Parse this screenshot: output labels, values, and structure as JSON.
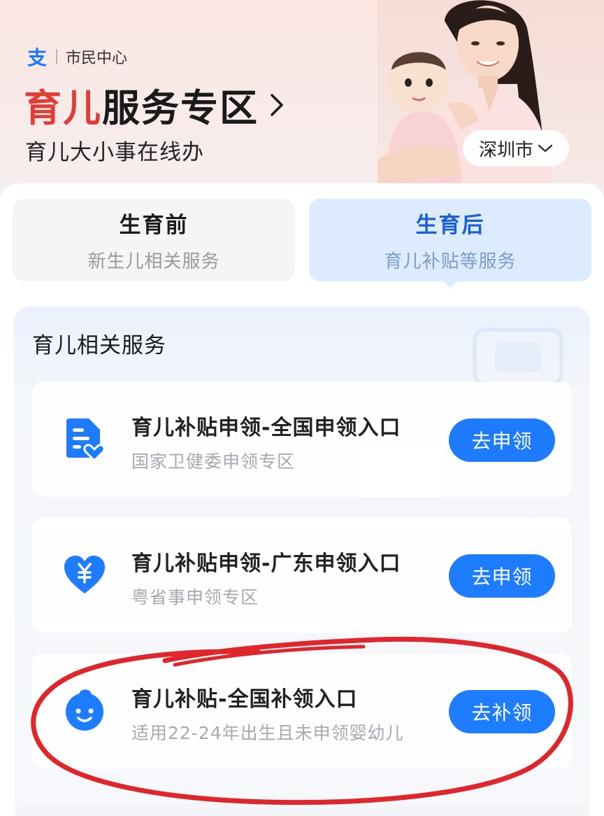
{
  "header": {
    "brand_logo": "支",
    "brand_name": "市民中心",
    "title_highlight": "育儿",
    "title_rest": "服务专区",
    "subtitle": "育儿大小事在线办",
    "city": "深圳市"
  },
  "tabs": [
    {
      "title": "生育前",
      "subtitle": "新生儿相关服务",
      "active": false
    },
    {
      "title": "生育后",
      "subtitle": "育儿补贴等服务",
      "active": true
    }
  ],
  "section_title": "育儿相关服务",
  "services": [
    {
      "title": "育儿补贴申领-全国申领入口",
      "desc": "国家卫健委申领专区",
      "button": "去申领",
      "icon": "document-heart-icon"
    },
    {
      "title": "育儿补贴申领-广东申领入口",
      "desc": "粤省事申领专区",
      "button": "去申领",
      "icon": "yuan-heart-icon"
    },
    {
      "title": "育儿补贴-全国补领入口",
      "desc": "适用22-24年出生且未申领婴幼儿",
      "button": "去补领",
      "icon": "baby-face-icon"
    }
  ],
  "colors": {
    "accent": "#1677ff",
    "title_red": "#e23d34",
    "active_tab_bg": "#dcebfd",
    "annotation_red": "#e0262a"
  }
}
